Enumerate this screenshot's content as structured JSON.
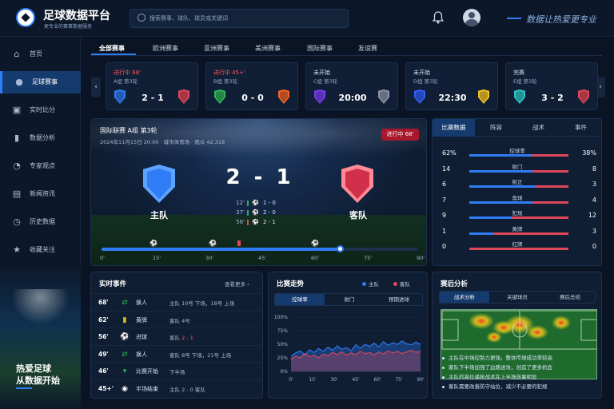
{
  "app": {
    "title": "足球数据平台",
    "subtitle": "更专业的赛事数据服务",
    "slogan": "数据让热爱更专业"
  },
  "search": {
    "placeholder": "搜索赛事、球队、球员或关键词"
  },
  "sidebar": {
    "items": [
      {
        "label": "首页",
        "icon": "home-icon",
        "active": false
      },
      {
        "label": "足球赛事",
        "icon": "soccer-ball-icon",
        "active": true
      },
      {
        "label": "实时比分",
        "icon": "scoreboard-icon",
        "active": false
      },
      {
        "label": "数据分析",
        "icon": "bar-chart-icon",
        "active": false
      },
      {
        "label": "专家观点",
        "icon": "chat-icon",
        "active": false
      },
      {
        "label": "新闻资讯",
        "icon": "news-icon",
        "active": false
      },
      {
        "label": "历史数据",
        "icon": "history-icon",
        "active": false
      },
      {
        "label": "收藏关注",
        "icon": "star-icon",
        "active": false
      }
    ],
    "promo": {
      "line1": "热爱足球",
      "line2": "从数据开始"
    }
  },
  "tabs": [
    "全部赛事",
    "欧洲赛事",
    "亚洲赛事",
    "美洲赛事",
    "国际赛事",
    "友谊赛"
  ],
  "match_cards": [
    {
      "status": "进行中 68'",
      "state": "live",
      "group": "A组 第3轮",
      "score": "2 - 1",
      "home_color": "#2f7cf6",
      "away_color": "#e0475a"
    },
    {
      "status": "进行中 45+'",
      "state": "live",
      "group": "B组 第3轮",
      "score": "0 - 0",
      "home_color": "#2fb35a",
      "away_color": "#f0642a"
    },
    {
      "status": "未开始",
      "state": "pre",
      "group": "C组 第3轮",
      "score": "20:00",
      "home_color": "#7a3ff0",
      "away_color": "#8a94a6"
    },
    {
      "status": "未开始",
      "state": "pre",
      "group": "D组 第3轮",
      "score": "22:30",
      "home_color": "#2f5ff6",
      "away_color": "#f0c02a"
    },
    {
      "status": "完赛",
      "state": "done",
      "group": "E组 第3轮",
      "score": "3 - 2",
      "home_color": "#2fc4c4",
      "away_color": "#e0475a"
    }
  ],
  "hero": {
    "league": "国际联赛   A组 第3轮",
    "meta": "2024年11月15日  20:00  ·  城市体育场  ·  观众 42,318",
    "badge": "进行中 68'",
    "home": "主队",
    "away": "客队",
    "score": "2 - 1",
    "goals": [
      {
        "minute": "12'",
        "score": "1 - 0",
        "side": "home"
      },
      {
        "minute": "37'",
        "score": "2 - 0",
        "side": "home"
      },
      {
        "minute": "56'",
        "score": "2 - 1",
        "side": "away"
      }
    ],
    "timeline_ticks": [
      "0'",
      "15'",
      "30'",
      "45'",
      "60'",
      "75'",
      "90'"
    ],
    "progress_minute": 68
  },
  "stats": {
    "tabs": [
      "比赛数据",
      "阵容",
      "战术",
      "事件"
    ],
    "rows": [
      {
        "label": "控球率",
        "home": "62%",
        "away": "38%",
        "h": 62,
        "a": 38
      },
      {
        "label": "射门",
        "home": "14",
        "away": "8",
        "h": 14,
        "a": 8
      },
      {
        "label": "射正",
        "home": "6",
        "away": "3",
        "h": 6,
        "a": 3
      },
      {
        "label": "角球",
        "home": "7",
        "away": "4",
        "h": 7,
        "a": 4
      },
      {
        "label": "犯规",
        "home": "9",
        "away": "12",
        "h": 9,
        "a": 12
      },
      {
        "label": "黄牌",
        "home": "1",
        "away": "3",
        "h": 1,
        "a": 3
      },
      {
        "label": "红牌",
        "home": "0",
        "away": "0",
        "h": 0,
        "a": 0
      }
    ]
  },
  "events": {
    "title": "实时事件",
    "more": "查看更多  ›",
    "rows": [
      {
        "minute": "68'",
        "icon": "substitution-icon",
        "type": "换人",
        "detail": "主队  10号 下场，18号 上场",
        "highlight": ""
      },
      {
        "minute": "62'",
        "icon": "yellow-card-icon",
        "type": "黄牌",
        "detail": "客队  4号",
        "highlight": ""
      },
      {
        "minute": "56'",
        "icon": "goal-ball-icon",
        "type": "进球",
        "detail": "客队  ",
        "highlight": "2 - 1"
      },
      {
        "minute": "49'",
        "icon": "substitution-icon",
        "type": "换人",
        "detail": "客队  8号 下场，21号 上场",
        "highlight": ""
      },
      {
        "minute": "46'",
        "icon": "kickoff-icon",
        "type": "比赛开始",
        "detail": "下半场",
        "highlight": ""
      },
      {
        "minute": "45+'",
        "icon": "halftime-icon",
        "type": "半场结束",
        "detail": "主队  2 - 0  客队",
        "highlight": ""
      }
    ]
  },
  "trend": {
    "title": "比赛走势",
    "legend": [
      "主队",
      "客队"
    ],
    "tabs": [
      "控球率",
      "射门",
      "预期进球"
    ],
    "chart_data": {
      "type": "area",
      "x": [
        "0'",
        "15'",
        "30'",
        "45'",
        "60'",
        "75'",
        "90'"
      ],
      "y_ticks": [
        "100%",
        "75%",
        "50%",
        "25%",
        "0%"
      ],
      "series": [
        {
          "name": "主队",
          "color": "#2f7cf6",
          "values": [
            28,
            34,
            38,
            30,
            40,
            35,
            42,
            37,
            45,
            39,
            47,
            41,
            44,
            38,
            49,
            43,
            50,
            46,
            52,
            45,
            55,
            48,
            53,
            50,
            56,
            51,
            49,
            54,
            50
          ]
        },
        {
          "name": "客队",
          "color": "#e0475a",
          "values": [
            22,
            28,
            25,
            33,
            27,
            30,
            25,
            32,
            29,
            35,
            31,
            36,
            30,
            34,
            31,
            37,
            33,
            35,
            30,
            36,
            32,
            38,
            34,
            37,
            33,
            36,
            39,
            35,
            37
          ]
        }
      ],
      "ylim": [
        0,
        100
      ]
    }
  },
  "post": {
    "title": "赛后分析",
    "tabs": [
      "战术分析",
      "关键球员",
      "赛后总结"
    ],
    "bullets": [
      "主队在中场控制力更强，整体传球成功率较高",
      "客队下半场加强了边路进攻，创造了更多机会",
      "主队的高位逼抢战术在上半场效果明显",
      "客队需要改善防守站位，减少不必要的犯规"
    ]
  }
}
